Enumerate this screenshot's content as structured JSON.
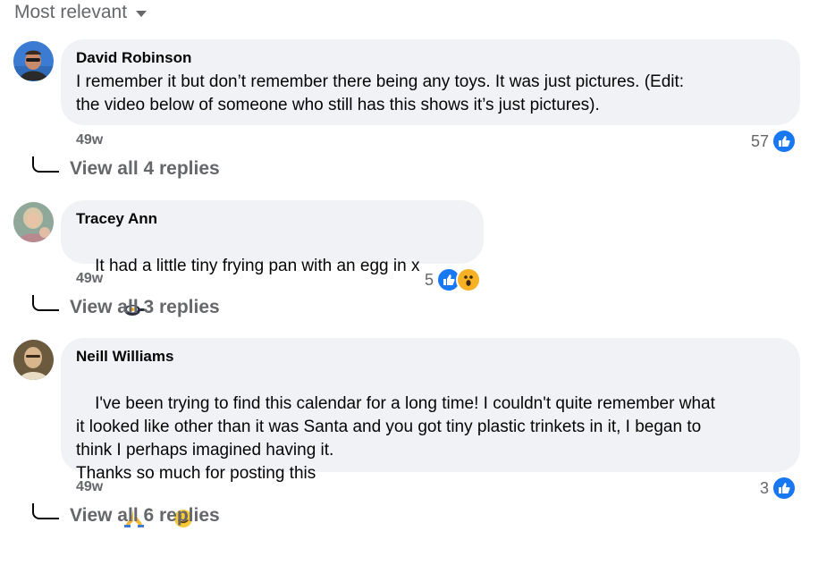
{
  "sort": {
    "label": "Most relevant"
  },
  "comments": [
    {
      "author": "David Robinson",
      "text": "I remember it but don’t remember there being any toys. It was just pictures. (Edit:\nthe video below of someone who still has this shows it’s just pictures).",
      "time": "49w",
      "reaction_count": "57",
      "reactions": [
        "like-icon"
      ],
      "replies_label": "View all 4 replies"
    },
    {
      "author": "Tracey Ann",
      "text": "It had a little tiny frying pan with an egg in x",
      "emoji_after_text": "frying-pan-emoji",
      "time": "49w",
      "reaction_count": "5",
      "reactions": [
        "like-icon",
        "wow-icon"
      ],
      "replies_label": "View all 3 replies"
    },
    {
      "author": "Neill Williams",
      "text": "I've been trying to find this calendar for a long time! I couldn't quite remember what\nit looked like other than it was Santa and you got tiny plastic trinkets in it, I began to\nthink I perhaps imagined having it.\nThanks so much for posting this",
      "emoji_after_text": [
        "praying-hands-emoji",
        "smiling-face-emoji"
      ],
      "time": "49w",
      "reaction_count": "3",
      "reactions": [
        "like-icon"
      ],
      "replies_label": "View all 6 replies"
    }
  ],
  "colors": {
    "bubble": "#f0f2f5",
    "muted_text": "#65676b",
    "like_blue": "#1877f2",
    "wow_yellow": "#f7b125"
  }
}
